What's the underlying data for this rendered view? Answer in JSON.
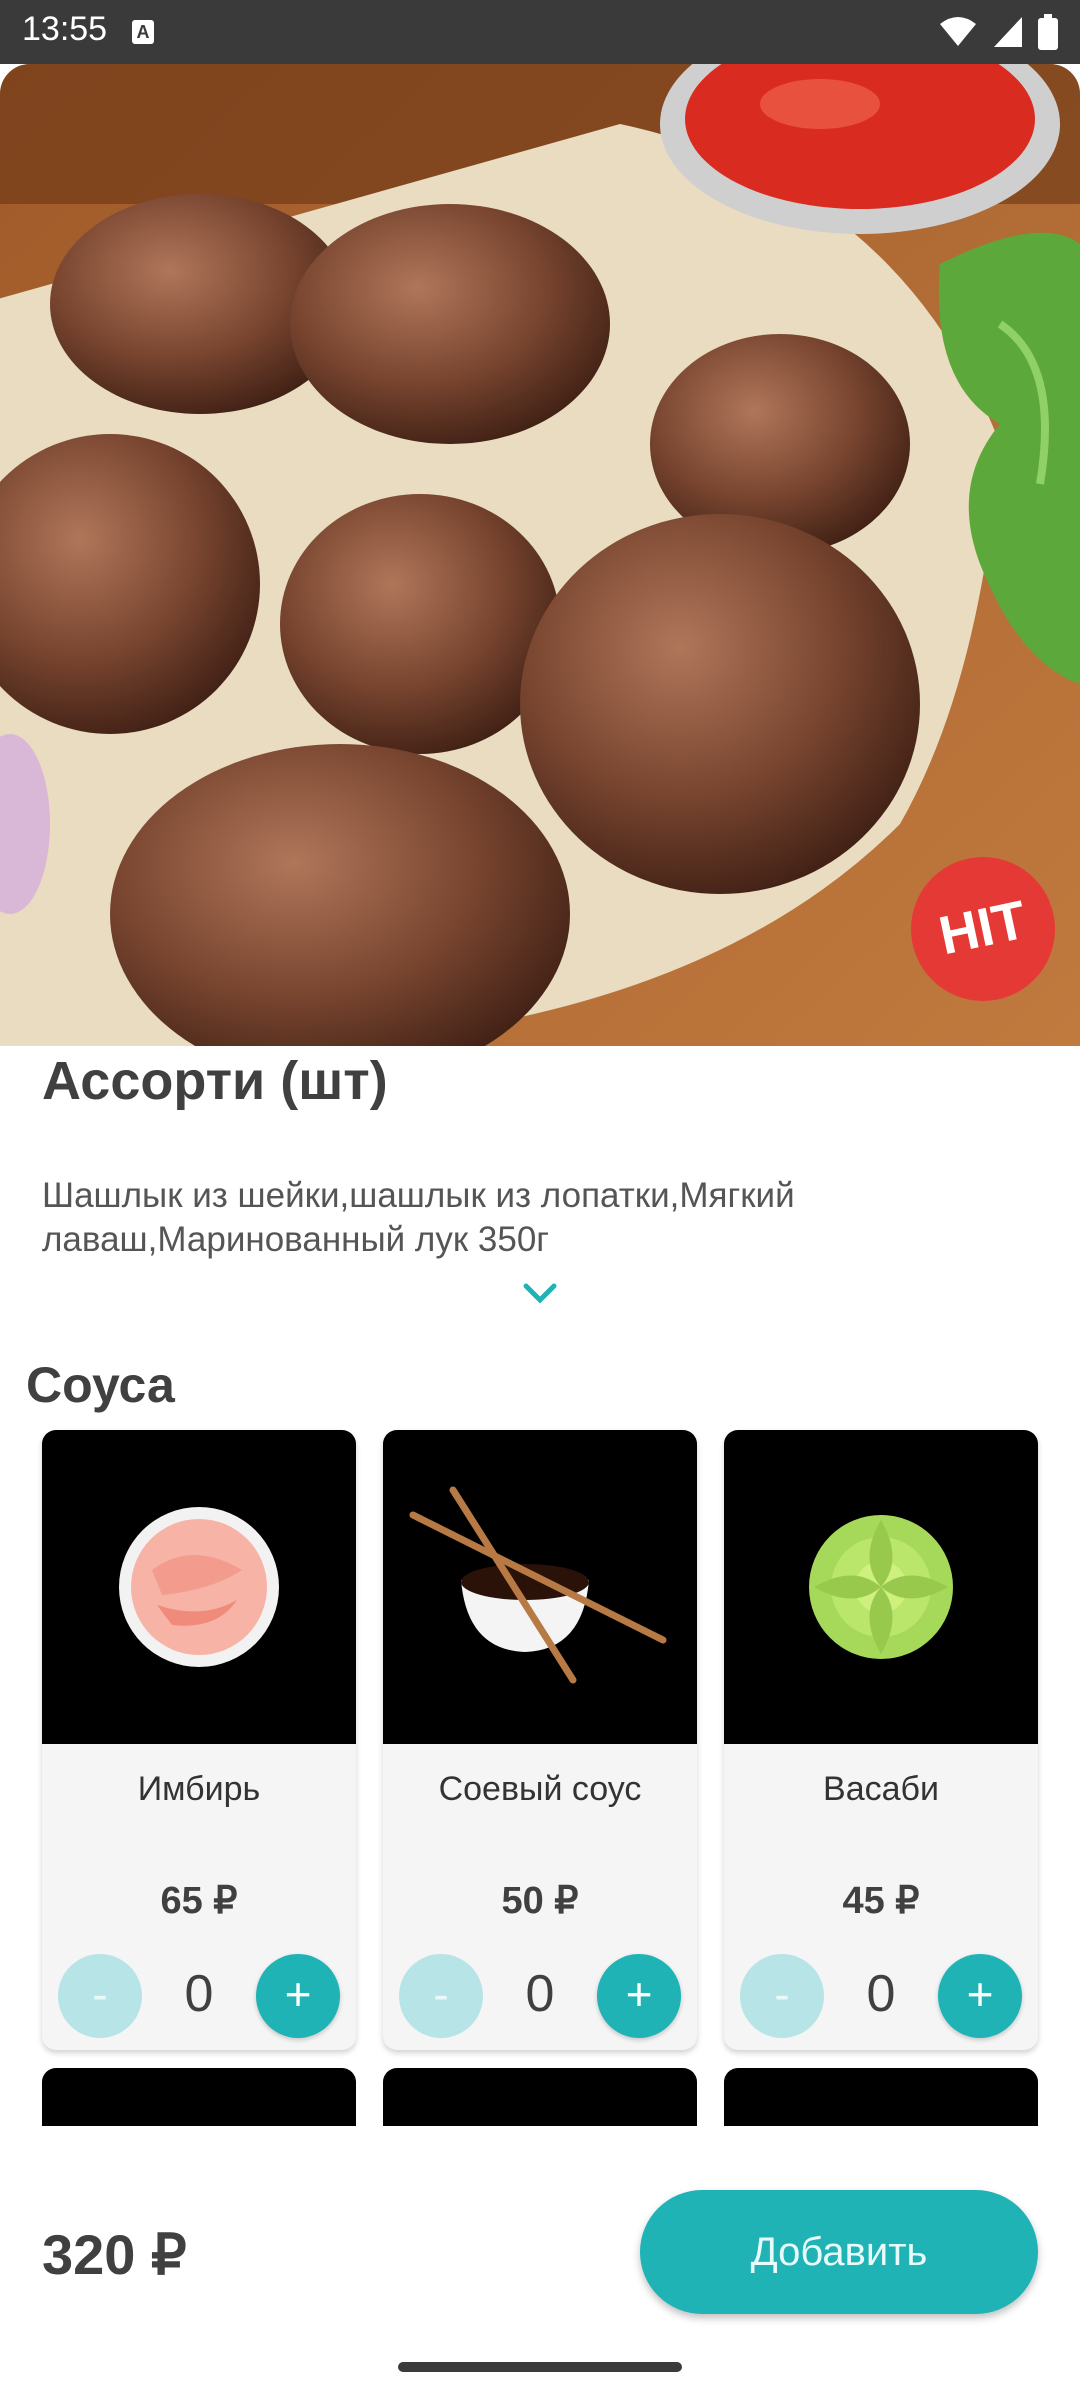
{
  "status_bar": {
    "time": "13:55",
    "notification_icon": "A"
  },
  "hero": {
    "badge": "HIT"
  },
  "product": {
    "title": "Ассорти (шт)",
    "description": "Шашлык из шейки,шашлык из лопатки,Мягкий лаваш,Маринованный лук 350г"
  },
  "section": {
    "title": "Соуса"
  },
  "sauces": [
    {
      "name": "Имбирь",
      "price": "65 ₽",
      "quantity": "0",
      "minus": "-",
      "plus": "+"
    },
    {
      "name": "Соевый соус",
      "price": "50 ₽",
      "quantity": "0",
      "minus": "-",
      "plus": "+"
    },
    {
      "name": "Васаби",
      "price": "45 ₽",
      "quantity": "0",
      "minus": "-",
      "plus": "+"
    }
  ],
  "footer": {
    "total": "320 ₽",
    "add_label": "Добавить"
  },
  "colors": {
    "accent": "#1fb3b6",
    "accent_light": "#b7e4e6",
    "badge": "#e53935"
  }
}
